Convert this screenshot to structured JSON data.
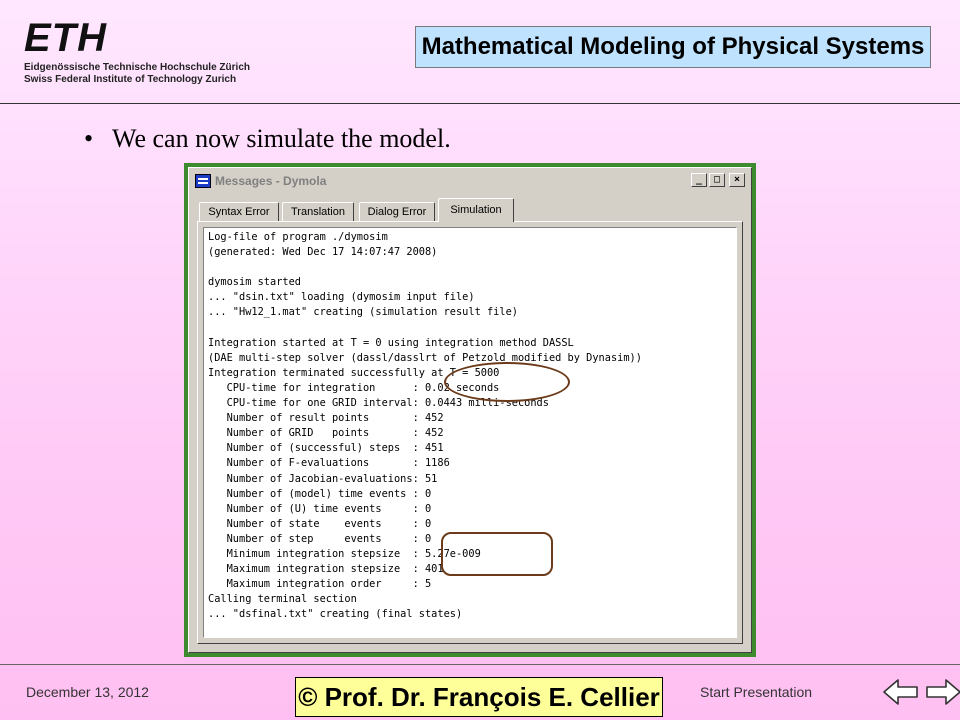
{
  "header": {
    "logo_text": "ETH",
    "logo_line1": "Eidgenössische Technische Hochschule Zürich",
    "logo_line2": "Swiss Federal Institute of Technology Zurich",
    "course_title": "Mathematical Modeling of Physical Systems"
  },
  "slide": {
    "bullet": "We can now simulate the model."
  },
  "window": {
    "title": "Messages - Dymola",
    "buttons": {
      "minimize": "_",
      "maximize": "□",
      "close": "×"
    },
    "tabs": [
      {
        "label": "Syntax Error",
        "active": false
      },
      {
        "label": "Translation",
        "active": false
      },
      {
        "label": "Dialog Error",
        "active": false
      },
      {
        "label": "Simulation",
        "active": true
      }
    ],
    "log_lines": [
      "Log-file of program ./dymosim",
      "(generated: Wed Dec 17 14:07:47 2008)",
      "",
      "dymosim started",
      "... \"dsin.txt\" loading (dymosim input file)",
      "... \"Hw12_1.mat\" creating (simulation result file)",
      "",
      "Integration started at T = 0 using integration method DASSL",
      "(DAE multi-step solver (dassl/dasslrt of Petzold modified by Dynasim))",
      "Integration terminated successfully at T = 5000",
      "   CPU-time for integration      : 0.02 seconds",
      "   CPU-time for one GRID interval: 0.0443 milli-seconds",
      "   Number of result points       : 452",
      "   Number of GRID   points       : 452",
      "   Number of (successful) steps  : 451",
      "   Number of F-evaluations       : 1186",
      "   Number of Jacobian-evaluations: 51",
      "   Number of (model) time events : 0",
      "   Number of (U) time events     : 0",
      "   Number of state    events     : 0",
      "   Number of step     events     : 0",
      "   Minimum integration stepsize  : 5.27e-009",
      "   Maximum integration stepsize  : 401",
      "   Maximum integration order     : 5",
      "Calling terminal section",
      "... \"dsfinal.txt\" creating (final states)"
    ]
  },
  "footer": {
    "date": "December 13, 2012",
    "credit": "© Prof. Dr. François E. Cellier",
    "start_link": "Start Presentation"
  },
  "colors": {
    "title_box": "#bfe3ff",
    "frame_green": "#3e8b2f",
    "credit_box": "#ffff99",
    "highlight": "#6b3b1a"
  }
}
